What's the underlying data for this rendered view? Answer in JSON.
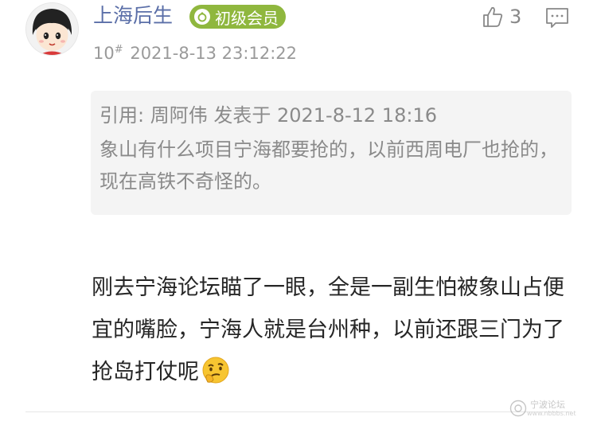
{
  "post": {
    "author": "上海后生",
    "badge": "初级会员",
    "floor_number": "10",
    "floor_mark": "#",
    "timestamp": "2021-8-13 23:12:22",
    "likes": "3",
    "quote": {
      "header": "引用: 周阿伟 发表于 2021-8-12 18:16",
      "text": "象山有什么项目宁海都要抢的，以前西周电厂也抢的，现在高铁不奇怪的。"
    },
    "content": "刚去宁海论坛瞄了一眼，全是一副生怕被象山占便宜的嘴脸，宁海人就是台州种，以前还跟三门为了抢岛打仗呢"
  },
  "icons": {
    "avatar": "cartoon-girl-avatar",
    "badge": "ring-badge-icon",
    "like": "thumbs-up-icon",
    "reply": "comment-bubble-icon",
    "emoji": "thinking-face-emoji"
  },
  "colors": {
    "author": "#5b6fa8",
    "badge_bg": "#8fb73e",
    "meta": "#9a9a9a",
    "quote_bg": "#f4f4f4"
  },
  "watermark": {
    "text": "宁波论坛",
    "sub": "www.nbbbs.net"
  }
}
